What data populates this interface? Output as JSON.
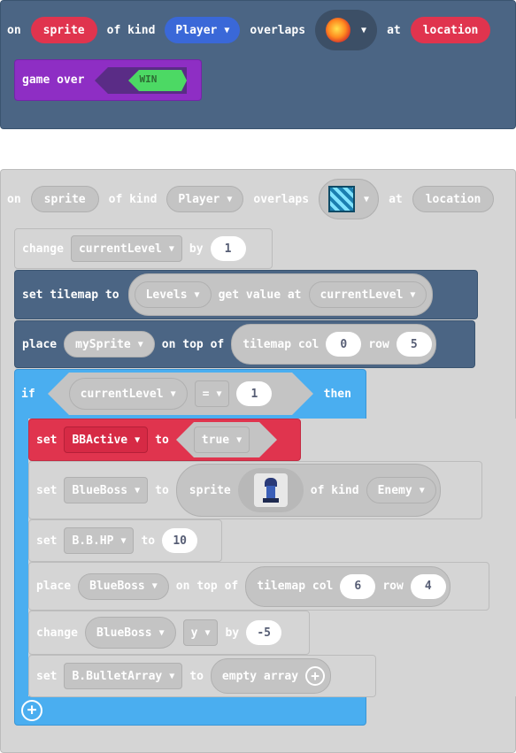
{
  "event1": {
    "kw_on": "on",
    "sprite_label": "sprite",
    "kw_of_kind": "of kind",
    "kind_value": "Player",
    "kw_overlaps": "overlaps",
    "kw_at": "at",
    "location_label": "location",
    "game_over_label": "game over",
    "win_value": "WIN"
  },
  "event2": {
    "kw_on": "on",
    "sprite_label": "sprite",
    "kw_of_kind": "of kind",
    "kind_value": "Player",
    "kw_overlaps": "overlaps",
    "kw_at": "at",
    "location_label": "location",
    "change1": {
      "kw": "change",
      "var": "currentLevel",
      "kw_by": "by",
      "amount": "1"
    },
    "set_tilemap": {
      "kw": "set tilemap to",
      "var": "Levels",
      "kw_get": "get value at",
      "index": "currentLevel"
    },
    "place1": {
      "kw": "place",
      "var": "mySprite",
      "kw_on_top": "on top of",
      "kw_tilemap": "tilemap col",
      "col": "0",
      "kw_row": "row",
      "row": "5"
    },
    "if_block": {
      "kw_if": "if",
      "var": "currentLevel",
      "op": "=",
      "value": "1",
      "kw_then": "then"
    },
    "set_bb": {
      "kw": "set",
      "var": "BBActive",
      "kw_to": "to",
      "value": "true"
    },
    "set_blueboss": {
      "kw": "set",
      "var": "BlueBoss",
      "kw_to": "to",
      "kw_sprite": "sprite",
      "kw_of_kind": "of kind",
      "kind": "Enemy"
    },
    "set_hp": {
      "kw": "set",
      "var": "B.B.HP",
      "kw_to": "to",
      "value": "10"
    },
    "place2": {
      "kw": "place",
      "var": "BlueBoss",
      "kw_on_top": "on top of",
      "kw_tilemap": "tilemap col",
      "col": "6",
      "kw_row": "row",
      "row": "4"
    },
    "change2": {
      "kw": "change",
      "var": "BlueBoss",
      "prop": "y",
      "kw_by": "by",
      "amount": "-5"
    },
    "set_array": {
      "kw": "set",
      "var": "B.BulletArray",
      "kw_to": "to",
      "value": "empty array"
    }
  },
  "colors": {
    "sprites_blue": "#4b6584",
    "variable_red": "#e0344e",
    "game_purple": "#8e2ec4",
    "logic_blue": "#4aaef0",
    "disabled_grey": "#d5d5d5"
  }
}
